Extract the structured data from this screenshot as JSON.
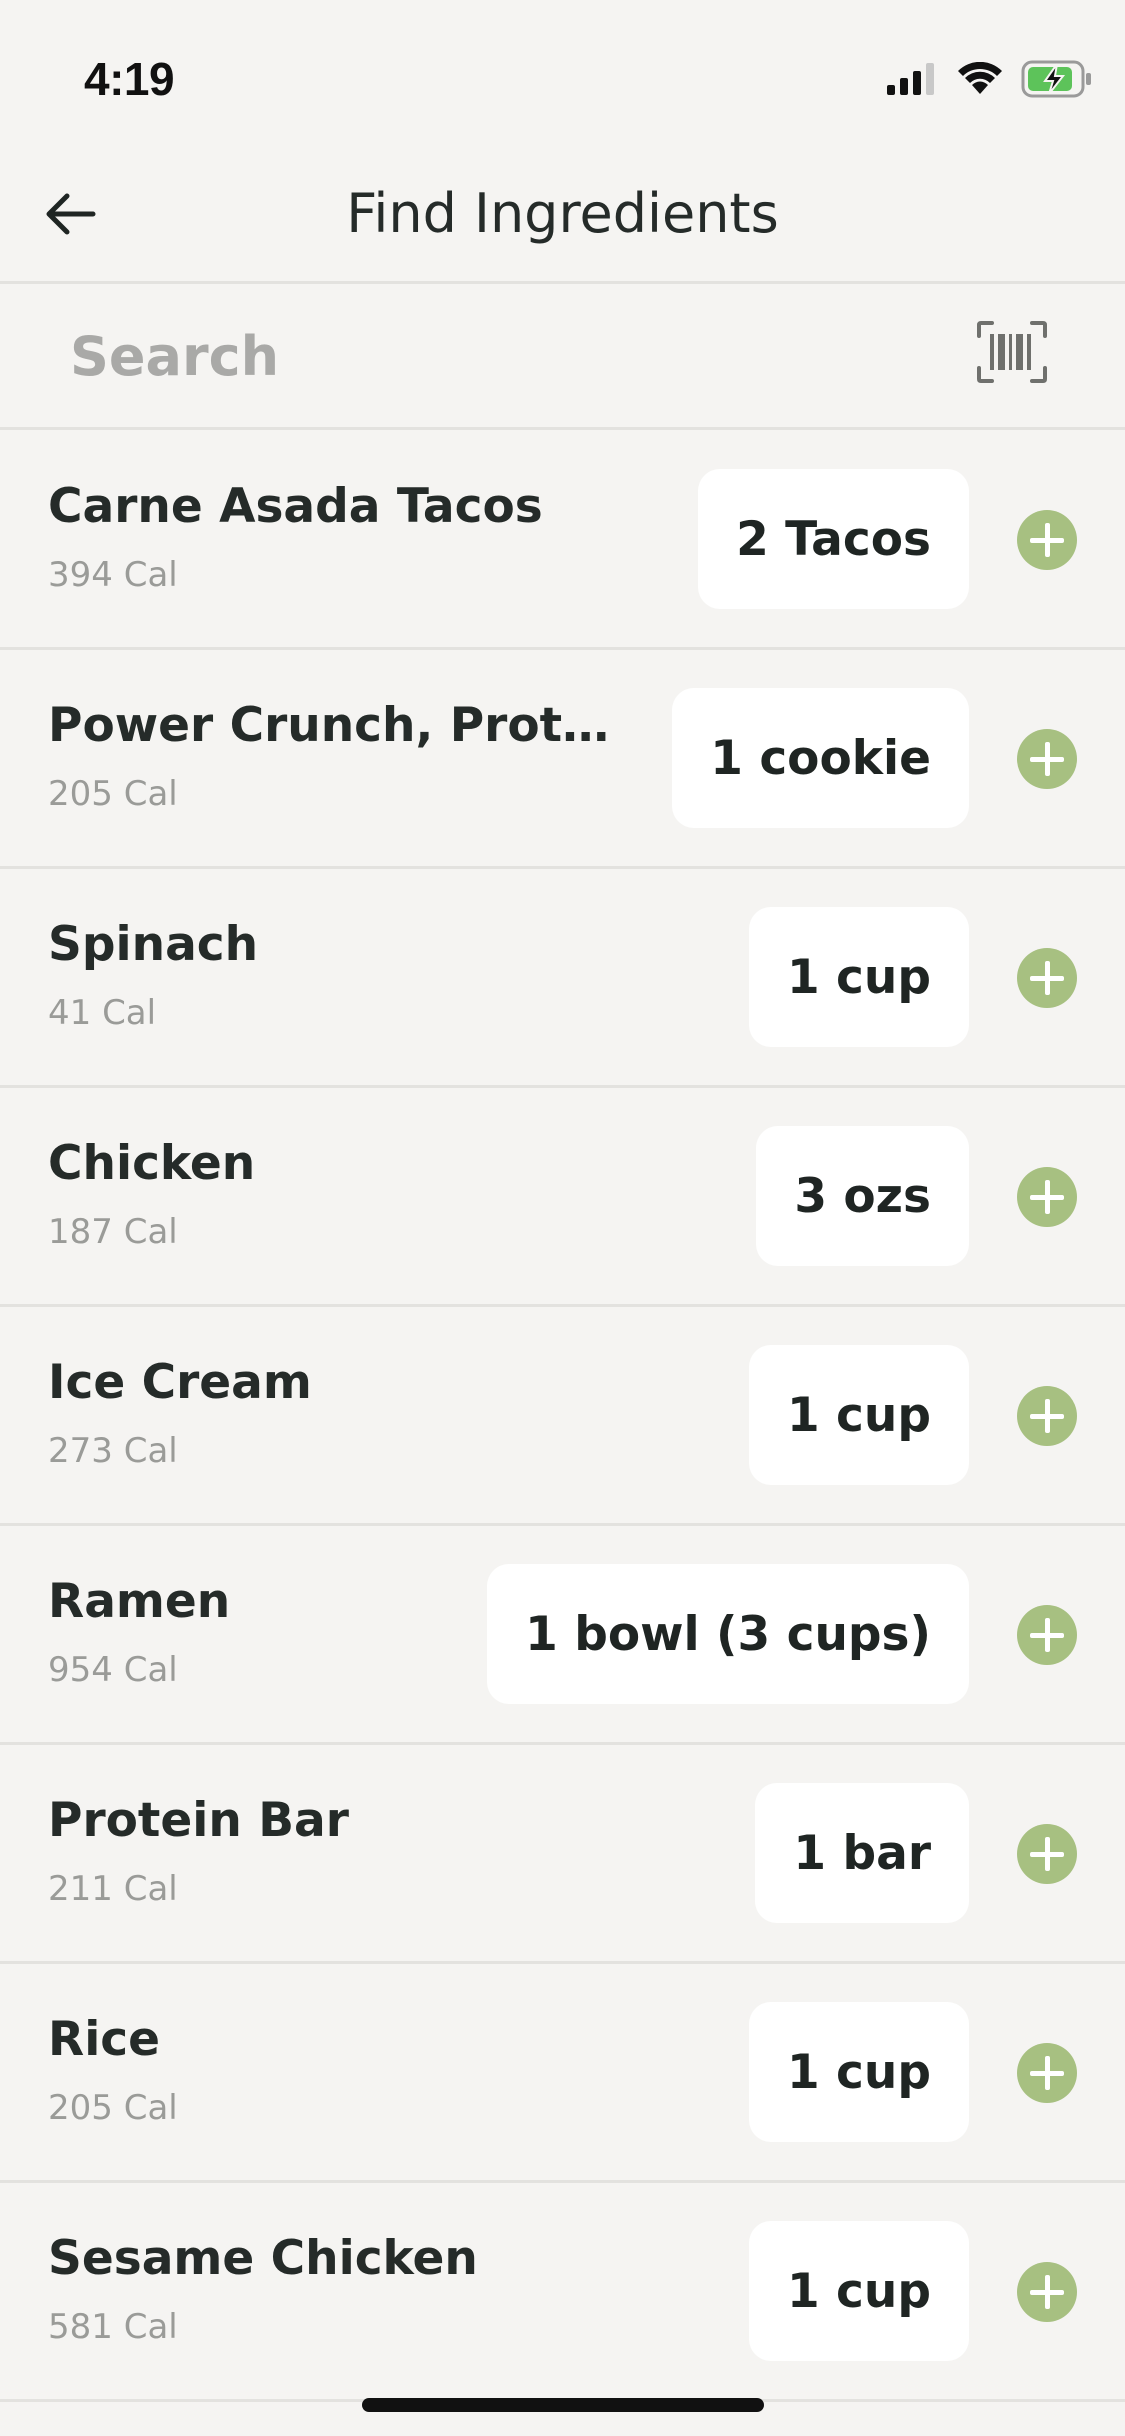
{
  "status": {
    "time": "4:19"
  },
  "nav": {
    "title": "Find Ingredients",
    "back_icon": "arrow-left-icon"
  },
  "search": {
    "placeholder": "Search",
    "value": "",
    "barcode_icon": "barcode-scan-icon"
  },
  "colors": {
    "background": "#f5f4f2",
    "add_button": "#a7c081",
    "serving_button": "#ffffff",
    "divider": "#e3e2df"
  },
  "items": [
    {
      "name": "Carne Asada Tacos",
      "calories": "394 Cal",
      "serving": "2 Tacos"
    },
    {
      "name": "Power Crunch, Protein…",
      "calories": "205 Cal",
      "serving": "1 cookie"
    },
    {
      "name": "Spinach",
      "calories": "41 Cal",
      "serving": "1 cup"
    },
    {
      "name": "Chicken",
      "calories": "187 Cal",
      "serving": "3 ozs"
    },
    {
      "name": "Ice Cream",
      "calories": "273 Cal",
      "serving": "1 cup"
    },
    {
      "name": "Ramen",
      "calories": "954 Cal",
      "serving": "1 bowl (3 cups)"
    },
    {
      "name": "Protein Bar",
      "calories": "211 Cal",
      "serving": "1 bar"
    },
    {
      "name": "Rice",
      "calories": "205 Cal",
      "serving": "1 cup"
    },
    {
      "name": "Sesame Chicken",
      "calories": "581 Cal",
      "serving": "1 cup"
    }
  ]
}
